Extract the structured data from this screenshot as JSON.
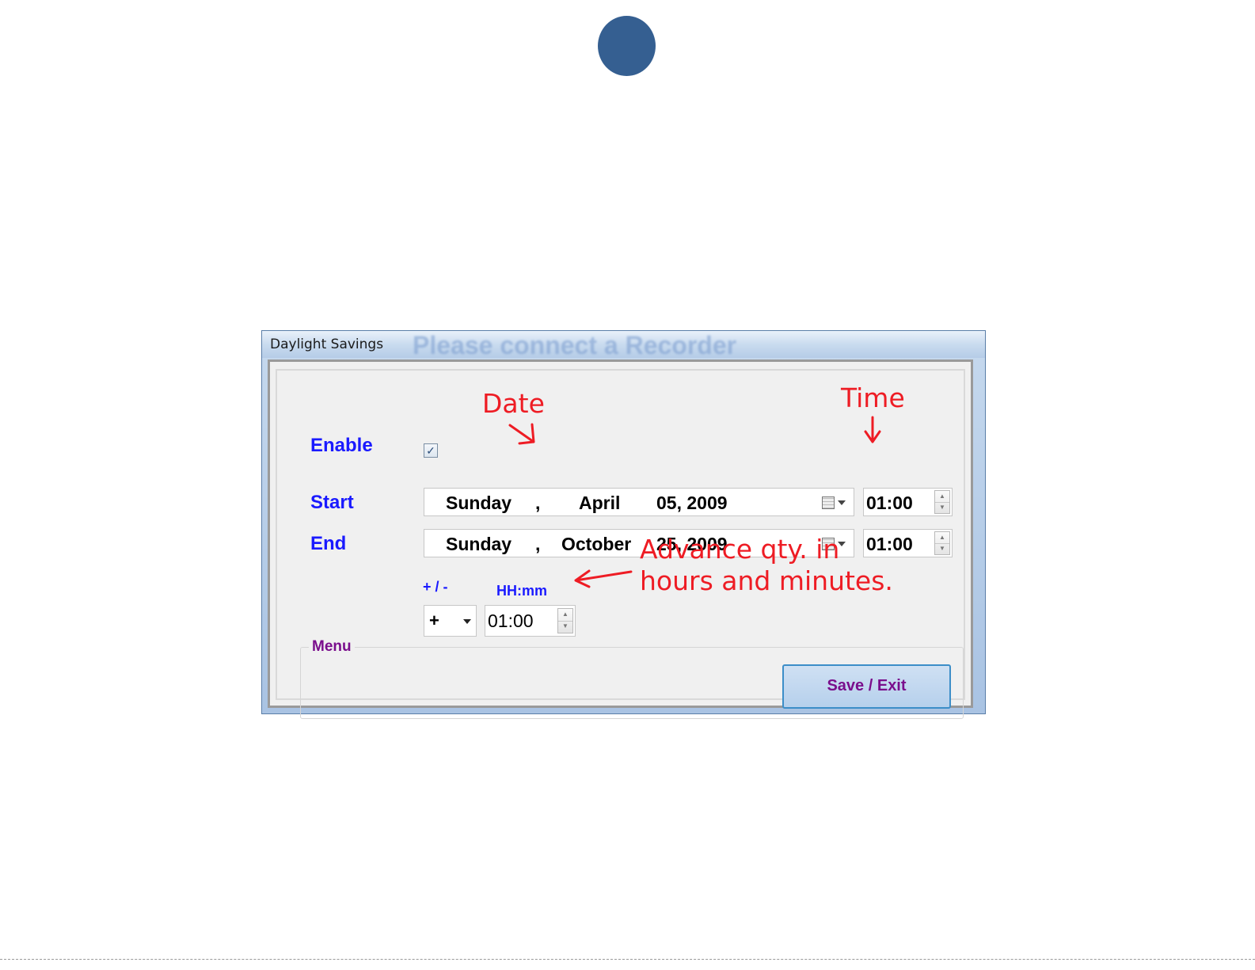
{
  "window": {
    "title": "Daylight Savings",
    "ghost_text": "Please connect a Recorder"
  },
  "labels": {
    "enable": "Enable",
    "start": "Start",
    "end": "End",
    "sign_header": "+ / -",
    "time_header": "HH:mm",
    "menu": "Menu"
  },
  "enable_checked": true,
  "start": {
    "day": "Sunday",
    "sep": ",",
    "month": "April",
    "date": "05, 2009",
    "time": "01:00"
  },
  "end": {
    "day": "Sunday",
    "sep": ",",
    "month": "October",
    "date": "25, 2009",
    "time": "01:00"
  },
  "advance": {
    "sign": "+",
    "time": "01:00"
  },
  "buttons": {
    "save_exit": "Save / Exit"
  },
  "annotations": {
    "date": "Date",
    "time": "Time",
    "advance_line1": "Advance qty. in",
    "advance_line2": "hours and minutes."
  },
  "colors": {
    "label_blue": "#1a1aff",
    "menu_purple": "#7a0e8c",
    "annotation_red": "#ee1c24",
    "dot_blue": "#355f91"
  },
  "icons": {
    "checkbox": "checkmark",
    "calendar": "calendar-dropdown-icon",
    "spinner": "up-down-arrows"
  }
}
